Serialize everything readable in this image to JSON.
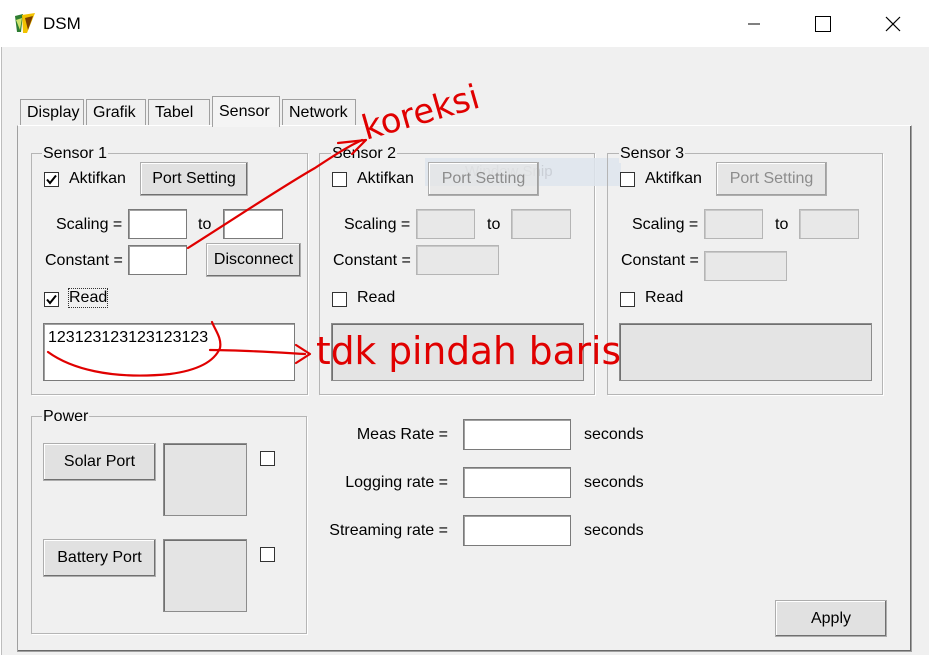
{
  "window": {
    "title": "DSM"
  },
  "tabs": [
    {
      "label": "Display",
      "active": false
    },
    {
      "label": "Grafik",
      "active": false
    },
    {
      "label": "Tabel",
      "active": false
    },
    {
      "label": "Sensor",
      "active": true
    },
    {
      "label": "Network",
      "active": false
    }
  ],
  "sensors": [
    {
      "title": "Sensor 1",
      "enable_label": "Aktifkan",
      "enabled": true,
      "port_setting_label": "Port Setting",
      "scaling_label": "Scaling =",
      "to_label": "to",
      "scaling_from": "",
      "scaling_to": "",
      "constant_label": "Constant =",
      "constant_value": "",
      "disconnect_label": "Disconnect",
      "read_label": "Read",
      "read_checked": true,
      "output_text": "123123123123123123"
    },
    {
      "title": "Sensor 2",
      "enable_label": "Aktifkan",
      "enabled": false,
      "port_setting_label": "Port Setting",
      "overlay_text": "Window Snip",
      "scaling_label": "Scaling =",
      "to_label": "to",
      "scaling_from": "",
      "scaling_to": "",
      "constant_label": "Constant =",
      "constant_value": "",
      "read_label": "Read",
      "read_checked": false,
      "output_text": ""
    },
    {
      "title": "Sensor 3",
      "enable_label": "Aktifkan",
      "enabled": false,
      "port_setting_label": "Port Setting",
      "scaling_label": "Scaling =",
      "to_label": "to",
      "scaling_from": "",
      "scaling_to": "",
      "constant_label": "Constant =",
      "constant_value": "",
      "read_label": "Read",
      "read_checked": false,
      "output_text": ""
    }
  ],
  "power": {
    "title": "Power",
    "solar_label": "Solar Port",
    "solar_checked": false,
    "battery_label": "Battery Port",
    "battery_checked": false
  },
  "rates": [
    {
      "label": "Meas Rate =",
      "value": "",
      "unit": "seconds"
    },
    {
      "label": "Logging rate =",
      "value": "",
      "unit": "seconds"
    },
    {
      "label": "Streaming rate =",
      "value": "",
      "unit": "seconds"
    }
  ],
  "apply_label": "Apply",
  "annotations": {
    "correction_note": "koreksi",
    "note": "tdk pindah baris",
    "ink_color": "#e00000"
  },
  "icons": {
    "app": "dsm-app-icon",
    "minimize": "minimize-icon",
    "maximize": "maximize-icon",
    "close": "close-icon",
    "check": "checkmark-icon"
  }
}
